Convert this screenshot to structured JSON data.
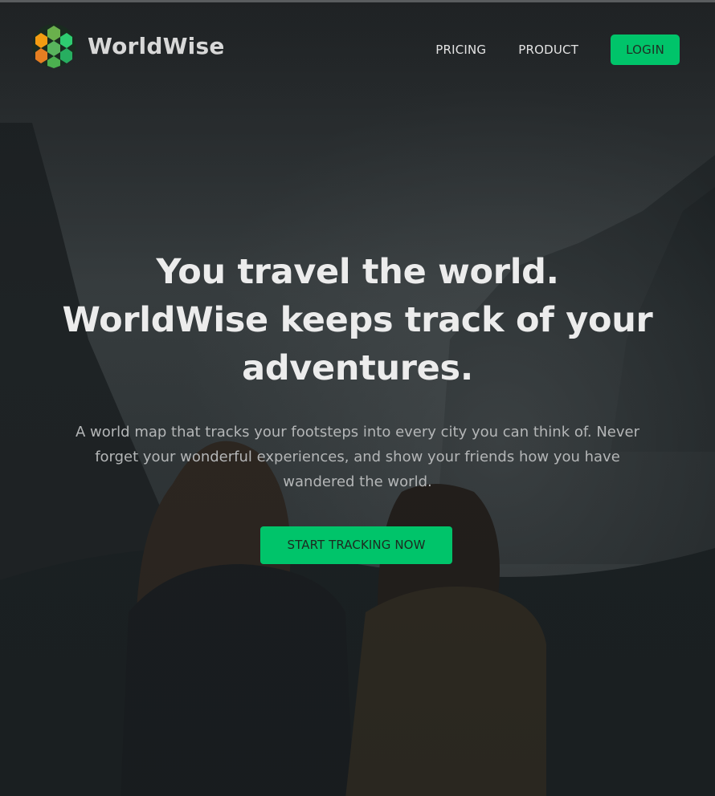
{
  "brand": {
    "name": "WorldWise",
    "logo_icon": "globe-hexagon-logo-icon",
    "colors": [
      "#f39c12",
      "#6ab04c",
      "#2ecc71"
    ]
  },
  "nav": {
    "links": [
      {
        "label": "PRICING"
      },
      {
        "label": "PRODUCT"
      }
    ],
    "login_label": "LOGIN"
  },
  "hero": {
    "title_lines": [
      "You travel the world.",
      "WorldWise keeps track of your",
      "adventures."
    ],
    "subtitle": "A world map that tracks your footsteps into every city you can think of. Never forget your wonderful experiences, and show your friends how you have wandered the world.",
    "cta_label": "START TRACKING NOW"
  },
  "theme": {
    "accent": "#00c46a",
    "background": "#1b1f21"
  }
}
